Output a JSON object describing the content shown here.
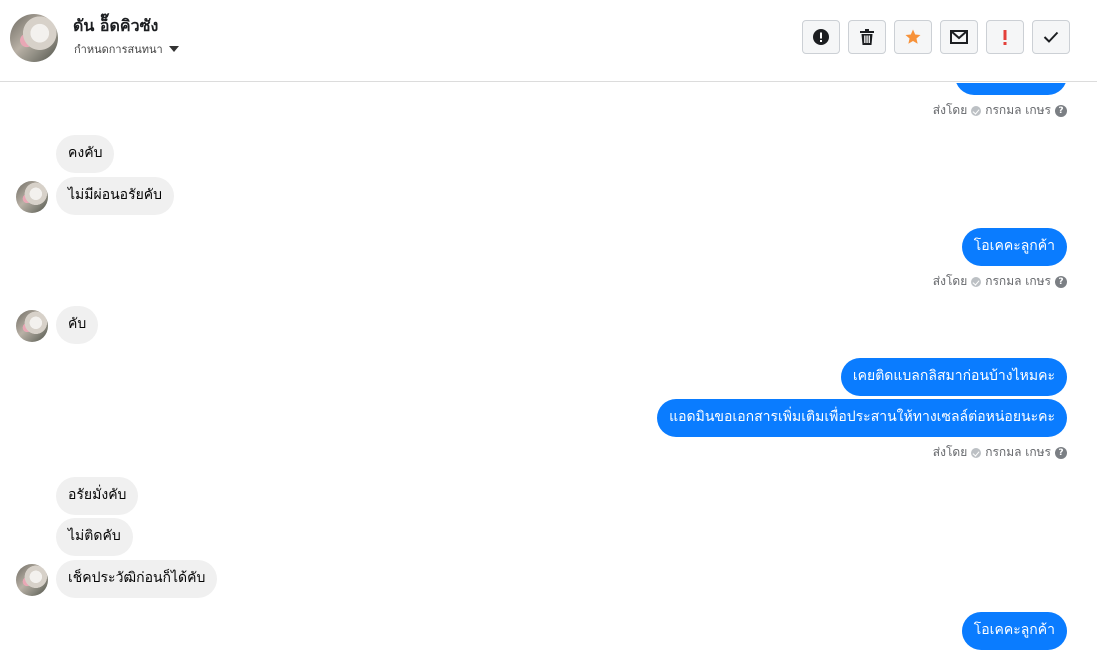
{
  "header": {
    "contact_name": "ดัน อ็๊ดคิวซัง",
    "conversation_label": "กำหนดการสนทนา",
    "icons": [
      "alert-circle-icon",
      "trash-icon",
      "star-icon",
      "mail-icon",
      "exclamation-icon",
      "check-icon"
    ],
    "colors": {
      "star": "#f7923a",
      "exclamation": "#e4403a",
      "outgoing_bubble": "#0a7cff"
    }
  },
  "chat": {
    "sent_by_prefix": "ส่งโดย",
    "sent_by_name": "กรกมล เกษร",
    "help_glyph": "?",
    "messages": [
      {
        "direction": "in",
        "text": "คงคับ"
      },
      {
        "direction": "in",
        "text": "ไม่มีผ่อนอรัยคับ"
      },
      {
        "direction": "out",
        "text": "โอเคคะลูกค้า"
      },
      {
        "direction": "in",
        "text": "คับ"
      },
      {
        "direction": "out",
        "text": "เคยติดแบลกลิสมาก่อนบ้างไหมคะ"
      },
      {
        "direction": "out",
        "text": "แอดมินขอเอกสารเพิ่มเติมเพื่อประสานให้ทางเซลล์ต่อหน่อยนะคะ"
      },
      {
        "direction": "in",
        "text": "อรัยมั่งคับ"
      },
      {
        "direction": "in",
        "text": "ไม่ติดคับ"
      },
      {
        "direction": "in",
        "text": "เช็คประวัฒิก่อนก็ได้คับ"
      },
      {
        "direction": "out",
        "text": "โอเคคะลูกค้า"
      }
    ]
  }
}
